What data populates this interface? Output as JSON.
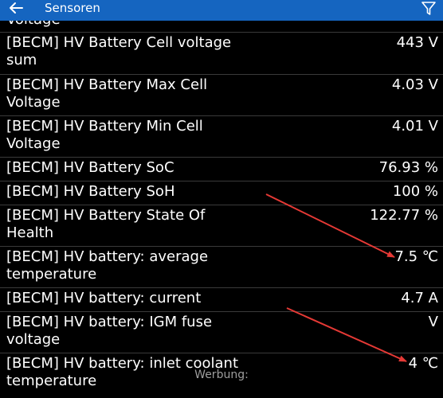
{
  "header": {
    "title": "Sensoren",
    "back_icon": "arrow-left-icon",
    "filter_icon": "filter-icon",
    "background": "#1565c0"
  },
  "list": {
    "partial_label": "Voltage",
    "rows": [
      {
        "name": "[BECM] HV Battery Cell voltage sum",
        "value": "443 V"
      },
      {
        "name": "[BECM] HV Battery Max Cell Voltage",
        "value": "4.03 V"
      },
      {
        "name": "[BECM] HV Battery Min Cell Voltage",
        "value": "4.01 V"
      },
      {
        "name": "[BECM] HV Battery SoC",
        "value": "76.93 %"
      },
      {
        "name": "[BECM] HV Battery SoH",
        "value": "100 %"
      },
      {
        "name": "[BECM] HV Battery State Of Health",
        "value": "122.77 %"
      },
      {
        "name": "[BECM] HV battery: average temperature",
        "value": "7.5 ℃"
      },
      {
        "name": "[BECM] HV battery: current",
        "value": "4.7 A"
      },
      {
        "name": "[BECM] HV battery: IGM fuse voltage",
        "value": "V"
      },
      {
        "name": "[BECM] HV battery: inlet coolant temperature",
        "value": "4 ℃"
      }
    ]
  },
  "ad": {
    "label": "Werbung:"
  },
  "annotations": {
    "arrow_color": "#e53935"
  }
}
